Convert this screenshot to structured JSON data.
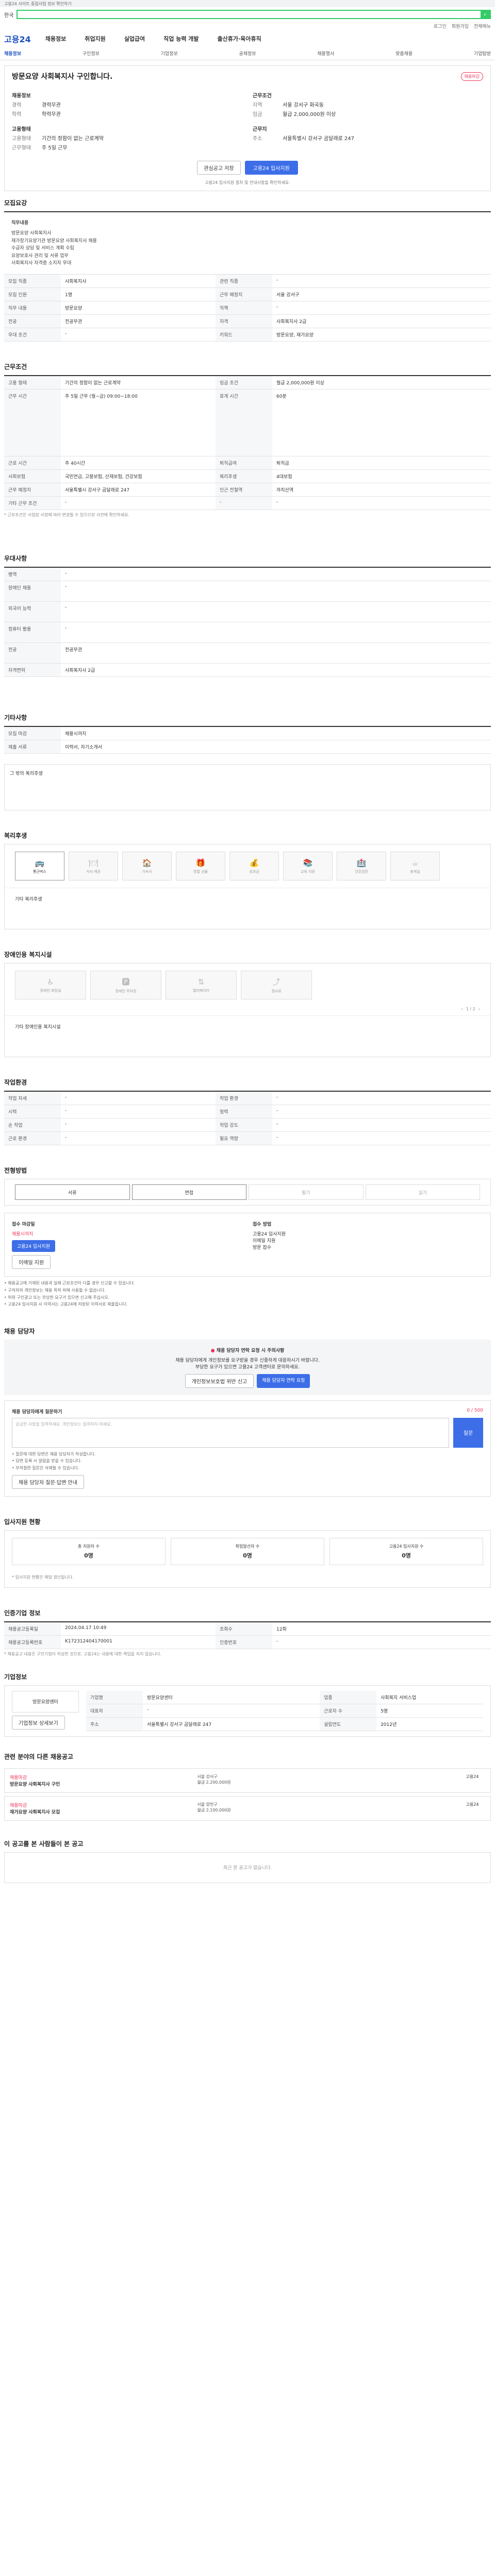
{
  "gb": "고용24 사이트 중점사업 정보 확인하기",
  "country": "한국",
  "util": [
    "로그인",
    "회원가입",
    "전체메뉴"
  ],
  "logo": "고용24",
  "gnav": [
    "채용정보",
    "취업지원",
    "실업급여",
    "직업 능력 개발",
    "출산휴가·육아휴직"
  ],
  "lnb": [
    "채용정보",
    "구인정보",
    "기업정보",
    "공채정보",
    "채용행사",
    "맞춤채용",
    "기업탐방"
  ],
  "job": {
    "title": "방문요양 사회복지사 구인합니다.",
    "badge": "채용마감"
  },
  "emp_label": "채용정보",
  "emp_rows": [
    [
      "경력",
      "경력무관"
    ],
    [
      "학력",
      "학력무관"
    ]
  ],
  "cond_label": "근무조건",
  "cond_rows": [
    [
      "지역",
      "서울 강서구 화곡동"
    ],
    [
      "임금",
      "월급 2,000,000원 이상"
    ]
  ],
  "type_label": "고용형태",
  "type_rows": [
    [
      "고용형태",
      "기간의 정함이 없는 근로계약"
    ],
    [
      "근무형태",
      "주 5일 근무"
    ]
  ],
  "addr_label": "근무지",
  "addr_rows": [
    [
      "주소",
      "서울특별시 강서구 곰달래로 247"
    ]
  ],
  "btn_scrap": "관심공고 저장",
  "btn_apply": "고용24 입사지원",
  "note": "고용24 입사지원 절차 및 안내사항을 확인하세요.",
  "s_recruit": "모집요강",
  "desc_title": "직무내용",
  "desc_lines": [
    "방문요양 사회복지사",
    "재가장기요양기관 방문요양 사회복지사 채용",
    "수급자 상담 및 서비스 계획 수립",
    "요양보호사 관리 및 서류 업무",
    "사회복지사 자격증 소지자 우대"
  ],
  "rec_rows": [
    [
      "모집 직종",
      "사회복지사",
      "관련 직종",
      "-"
    ],
    [
      "모집 인원",
      "1명",
      "근무 예정지",
      "서울 강서구"
    ],
    [
      "직무 내용",
      "방문요양",
      "직책",
      "-"
    ],
    [
      "전공",
      "전공무관",
      "자격",
      "사회복지사 2급"
    ],
    [
      "우대 조건",
      "-",
      "키워드",
      "방문요양, 재가요양"
    ]
  ],
  "s_work": "근무조건",
  "work_rows": [
    [
      "고용 형태",
      "기간의 정함이 없는 근로계약",
      "임금 조건",
      "월급 2,000,000원 이상"
    ],
    [
      "근무 시간",
      "주 5일 근무 (월~금) 09:00~18:00",
      "휴게 시간",
      "60분"
    ],
    [
      "근로 시간",
      "주 40시간",
      "퇴직급여",
      "퇴직금"
    ],
    [
      "사회보험",
      "국민연금, 고용보험, 산재보험, 건강보험",
      "복리후생",
      "4대보험"
    ],
    [
      "근무 예정지",
      "서울특별시 강서구 곰달래로 247",
      "인근 전철역",
      "까치산역"
    ],
    [
      "기타 근무 조건",
      "-",
      "-",
      "-"
    ]
  ],
  "work_note": "* 근로조건은 사업장 사정에 따라 변경될 수 있으므로 사전에 확인하세요.",
  "s_pref": "우대사항",
  "pref_rows": [
    [
      "병역",
      "-"
    ],
    [
      "장애인 채용",
      "-"
    ],
    [
      "외국어 능력",
      "-"
    ],
    [
      "컴퓨터 활용",
      "-"
    ],
    [
      "전공",
      "전공무관"
    ],
    [
      "자격면허",
      "사회복지사 2급"
    ]
  ],
  "s_etc": "기타사항",
  "etc_rows": [
    [
      "모집 마감",
      "채용시까지"
    ],
    [
      "제출 서류",
      "이력서, 자기소개서"
    ]
  ],
  "etc_text": "그 밖의 복리후생",
  "s_welfare": "복리후생",
  "welfare": [
    [
      "🚌",
      "통근버스",
      true
    ],
    [
      "🍽",
      "식사 제공",
      false
    ],
    [
      "🏠",
      "기숙사",
      false
    ],
    [
      "🎁",
      "명절 선물",
      false
    ],
    [
      "💰",
      "성과금",
      false
    ],
    [
      "📚",
      "교육 지원",
      false
    ],
    [
      "🏥",
      "건강검진",
      false
    ],
    [
      "☕",
      "휴게실",
      false
    ]
  ],
  "welfare_etc": "기타 복리후생",
  "s_disabled": "장애인용 복지시설",
  "disabled": [
    [
      "♿",
      "장애인 화장실",
      false
    ],
    [
      "🅿",
      "장애인 주차장",
      false
    ],
    [
      "⇅",
      "엘리베이터",
      false
    ],
    [
      "⤴",
      "경사로",
      false
    ]
  ],
  "disabled_etc": "기타 장애인용 복지시설",
  "pager": "1 / 2",
  "s_env": "작업환경",
  "env_rows": [
    [
      "작업 자세",
      "-",
      "작업 환경",
      "-"
    ],
    [
      "시력",
      "-",
      "청력",
      "-"
    ],
    [
      "손 작업",
      "-",
      "작업 강도",
      "-"
    ],
    [
      "근로 환경",
      "-",
      "필요 역량",
      "-"
    ]
  ],
  "s_method": "전형방법",
  "methods": [
    [
      "서류",
      true
    ],
    [
      "면접",
      true
    ],
    [
      "필기",
      false
    ],
    [
      "실기",
      false
    ]
  ],
  "apply_left": {
    "t": "접수 마감일",
    "d": "채용시까지",
    "b1": "고용24 입사지원",
    "b2": "이메일 지원"
  },
  "apply_right": {
    "t": "접수 방법",
    "l1": "고용24 입사지원",
    "l2": "이메일 지원",
    "l3": "방문 접수"
  },
  "bullets": [
    "채용공고에 기재된 내용과 실제 근로조건이 다를 경우 신고할 수 있습니다.",
    "구직자의 개인정보는 채용 목적 외에 사용할 수 없습니다.",
    "허위 구인광고 또는 부당한 요구가 있으면 신고해 주십시오.",
    "고용24 입사지원 시 이력서는 고용24에 저장된 이력서로 제출됩니다."
  ],
  "s_qa": "채용 담당자",
  "qa_warn": "채용 담당자 연락 요청 시 주의사항",
  "qa_lines": [
    "채용 담당자에게 개인정보를 요구받을 경우 신중하게 대응하시기 바랍니다.",
    "부당한 요구가 있으면 고용24 고객센터로 문의하세요."
  ],
  "qa_b1": "개인정보보호법 위반 신고",
  "qa_b2": "채용 담당자 연락 요청",
  "qa_title": "채용 담당자에게 질문하기",
  "qa_ph": "궁금한 사항을 입력하세요. 개인정보는 입력하지 마세요.",
  "qa_send": "질문",
  "qa_count": "0 / 500",
  "qa_bul": [
    "질문에 대한 답변은 채용 담당자가 작성합니다.",
    "답변 등록 시 알림을 받을 수 있습니다.",
    "부적절한 질문은 삭제될 수 있습니다."
  ],
  "qa_foot": "채용 담당자 질문·답변 안내",
  "s_stats": "입사지원 현황",
  "stats": [
    [
      "총 지원자 수",
      "0명"
    ],
    [
      "취업알선자 수",
      "0명"
    ],
    [
      "고용24 입사지원 수",
      "0명"
    ]
  ],
  "stats_note": "* 입사지원 현황은 매일 갱신됩니다.",
  "s_info": "인증기업 정보",
  "info_rows": [
    [
      "채용공고등록일",
      "2024.04.17 10:49",
      "조회수",
      "12회"
    ],
    [
      "채용공고등록번호",
      "K172312404170001",
      "인증번호",
      "-"
    ]
  ],
  "info_note": "* 채용공고 내용은 구인기업이 작성한 것으로, 고용24는 내용에 대한 책임을 지지 않습니다.",
  "s_company": "기업정보",
  "company": {
    "logo": "방문요양센터",
    "b": "기업정보 상세보기",
    "rows": [
      [
        "기업명",
        "방문요양센터",
        "업종",
        "사회복지 서비스업"
      ],
      [
        "대표자",
        "-",
        "근로자 수",
        "5명"
      ],
      [
        "주소",
        "서울특별시 강서구 곰달래로 247",
        "설립연도",
        "2012년"
      ]
    ]
  },
  "s_related": "관련 분야의 다른 채용공고",
  "related": [
    [
      "채용마감",
      "방문요양 사회복지사 구인",
      "서울 강서구",
      "월급 2,200,000원",
      "고용24"
    ],
    [
      "채용마감",
      "재가요양 사회복지사 모집",
      "서울 양천구",
      "월급 2,100,000원",
      "고용24"
    ]
  ],
  "s_viewed": "이 공고를 본 사람들이 본 공고",
  "viewed_empty": "최근 본 공고가 없습니다.",
  "colors": {
    "brand": "#1d4fbf",
    "accent": "#3d6ee8",
    "alert": "#ee3355"
  }
}
